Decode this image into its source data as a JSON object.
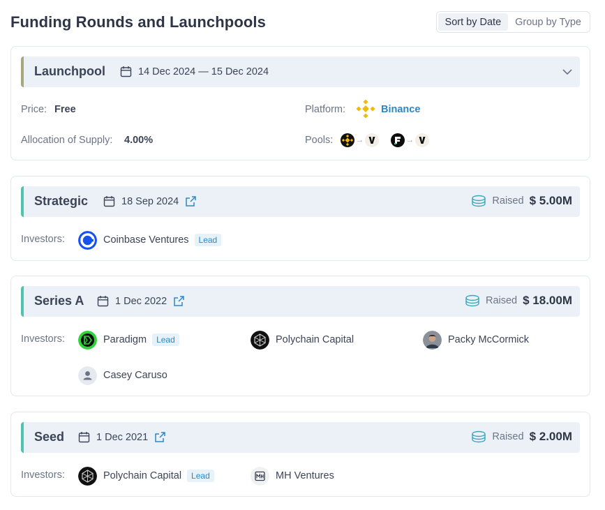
{
  "page": {
    "title": "Funding Rounds and Launchpools"
  },
  "sort_toggle": {
    "options": [
      "Sort by Date",
      "Group by Type"
    ],
    "active": "Sort by Date"
  },
  "launchpool": {
    "name": "Launchpool",
    "date": "14 Dec 2024 — 15 Dec 2024",
    "price_label": "Price:",
    "price_value": "Free",
    "allocation_label": "Allocation of Supply:",
    "allocation_value": "4.00%",
    "platform_label": "Platform:",
    "platform_name": "Binance",
    "pools_label": "Pools:",
    "pools": [
      {
        "stake_token_icon": "bnb-token-icon",
        "reward_token_icon": "usual-token-icon"
      },
      {
        "stake_token_icon": "fdusd-token-icon",
        "reward_token_icon": "usual-token-icon"
      }
    ]
  },
  "rounds": [
    {
      "name": "Strategic",
      "date": "18 Sep 2024",
      "raised_label": "Raised",
      "raised_amount": "$ 5.00M",
      "investors_label": "Investors:",
      "investors": [
        {
          "name": "Coinbase Ventures",
          "lead": true,
          "lead_label": "Lead",
          "icon": "coinbase-logo-icon"
        }
      ]
    },
    {
      "name": "Series A",
      "date": "1 Dec 2022",
      "raised_label": "Raised",
      "raised_amount": "$ 18.00M",
      "investors_label": "Investors:",
      "investors": [
        {
          "name": "Paradigm",
          "lead": true,
          "lead_label": "Lead",
          "icon": "paradigm-logo-icon"
        },
        {
          "name": "Polychain Capital",
          "lead": false,
          "icon": "polychain-logo-icon"
        },
        {
          "name": "Packy McCormick",
          "lead": false,
          "icon": "person-avatar-icon"
        },
        {
          "name": "Casey Caruso",
          "lead": false,
          "icon": "user-placeholder-icon"
        }
      ]
    },
    {
      "name": "Seed",
      "date": "1 Dec 2021",
      "raised_label": "Raised",
      "raised_amount": "$ 2.00M",
      "investors_label": "Investors:",
      "investors": [
        {
          "name": "Polychain Capital",
          "lead": true,
          "lead_label": "Lead",
          "icon": "polychain-logo-icon"
        },
        {
          "name": "MH Ventures",
          "lead": false,
          "icon": "mh-ventures-logo-icon"
        }
      ]
    }
  ],
  "colors": {
    "accent_teal": "#4fc2b0",
    "accent_olive": "#a7a77e",
    "link_blue": "#2b87c5",
    "header_bg": "#ecf1f8",
    "binance_yellow": "#f0b90b",
    "coinbase_blue": "#1652f0",
    "paradigm_green": "#30d33a"
  }
}
